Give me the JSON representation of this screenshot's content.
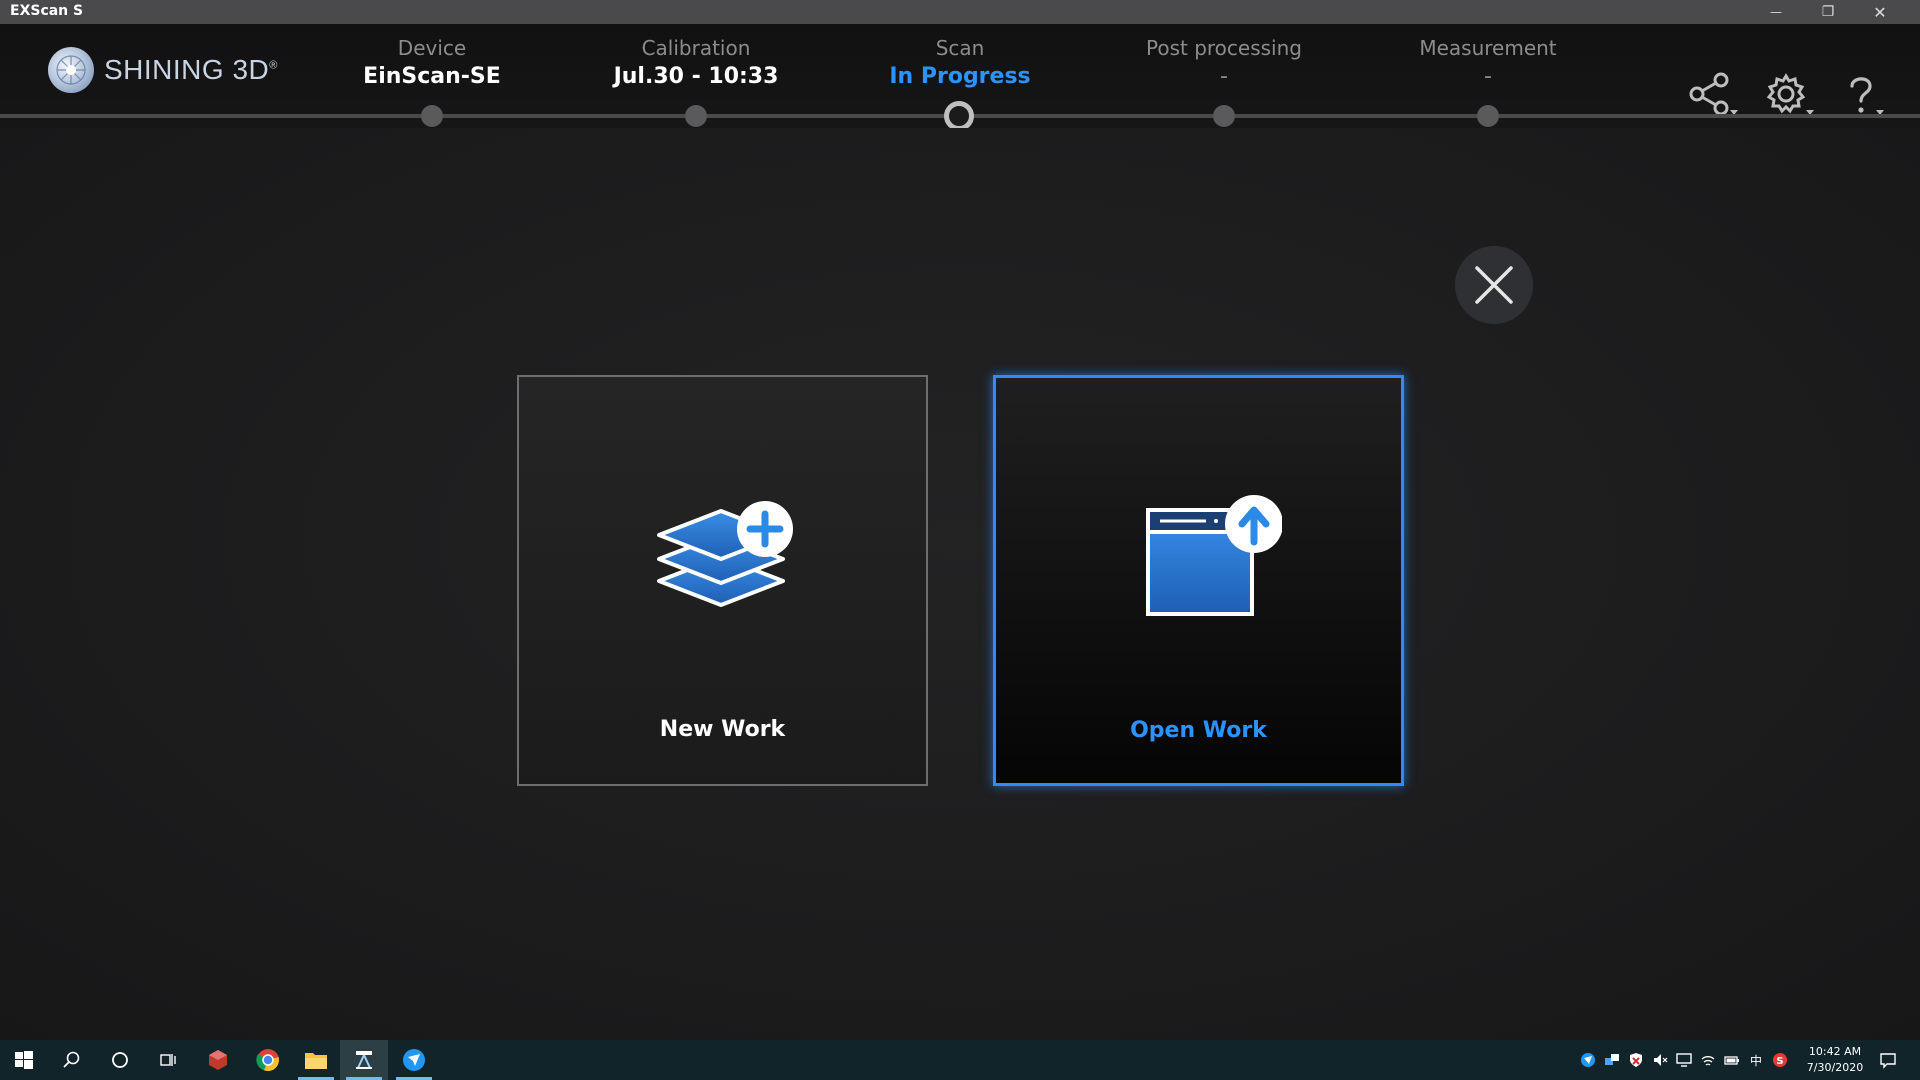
{
  "window": {
    "title": "EXScan S",
    "minimize_glyph": "—",
    "restore_glyph": "❐",
    "close_glyph": "✕"
  },
  "brand": {
    "name": "SHINING 3D",
    "reg_mark": "®"
  },
  "steps": [
    {
      "label": "Device",
      "value": "EinScan-SE"
    },
    {
      "label": "Calibration",
      "value": "Jul.30 - 10:33"
    },
    {
      "label": "Scan",
      "value": "In Progress"
    },
    {
      "label": "Post processing",
      "value": "-"
    },
    {
      "label": "Measurement",
      "value": "-"
    }
  ],
  "toolbar_icons": [
    "share-icon",
    "gear-icon",
    "help-icon"
  ],
  "cards": {
    "new_work": {
      "label": "New Work",
      "icon": "layers-plus-icon"
    },
    "open_work": {
      "label": "Open Work",
      "icon": "window-upload-icon"
    }
  },
  "colors": {
    "accent": "#2a93ff",
    "card_border": "#6e6e6e",
    "background": "#1b1b1c",
    "taskbar": "#10242a"
  },
  "taskbar": {
    "clock_time": "10:42 AM",
    "clock_date": "7/30/2020",
    "ime_label": "中"
  }
}
